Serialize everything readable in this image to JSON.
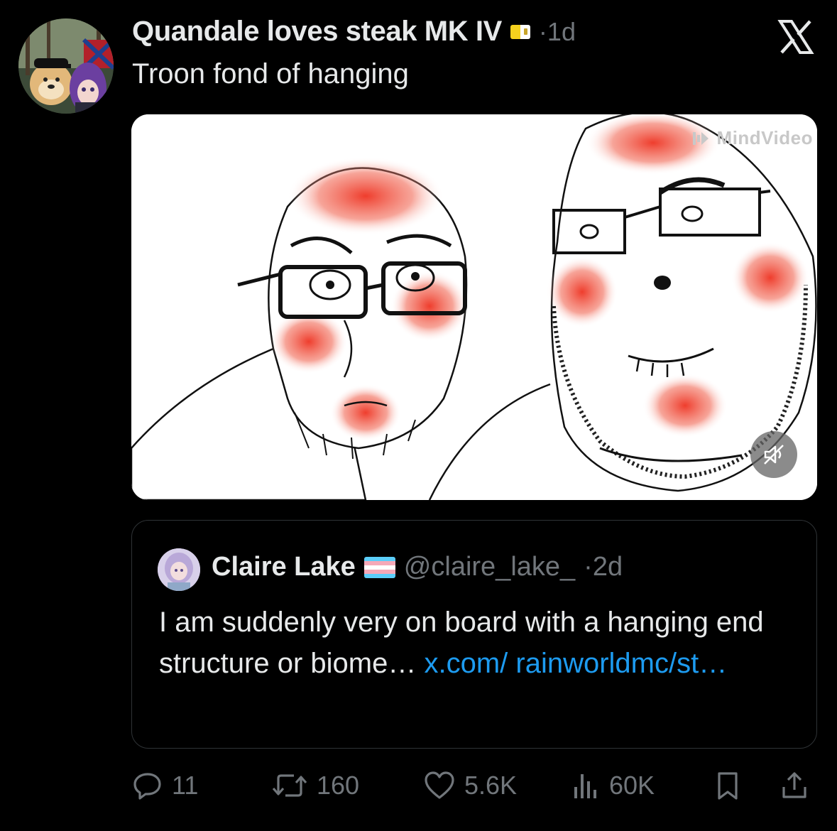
{
  "post": {
    "display_name": "Quandale loves steak MK IV",
    "separator": "·",
    "time": "1d",
    "text": "Troon fond of hanging",
    "avatar_icon": "avatar-dog-and-anime-girl",
    "flag_icon": "vatican-flag-icon"
  },
  "media": {
    "watermark": "MindVideo",
    "mute_icon": "muted-speaker-icon"
  },
  "quote": {
    "display_name": "Claire Lake",
    "flag_icon": "trans-flag-icon",
    "handle": "@claire_lake_",
    "separator": "·",
    "time": "2d",
    "text": "I am suddenly very on board with a hanging end structure or biome… ",
    "link_text": "x.com/ rainworldmc/st…",
    "link_color": "#1d9bf0"
  },
  "actions": {
    "replies": "11",
    "reposts": "160",
    "likes": "5.6K",
    "views": "60K"
  },
  "colors": {
    "background": "#000000",
    "text": "#e7e9ea",
    "muted": "#71767b",
    "border": "#2f3336",
    "accent": "#1d9bf0"
  }
}
